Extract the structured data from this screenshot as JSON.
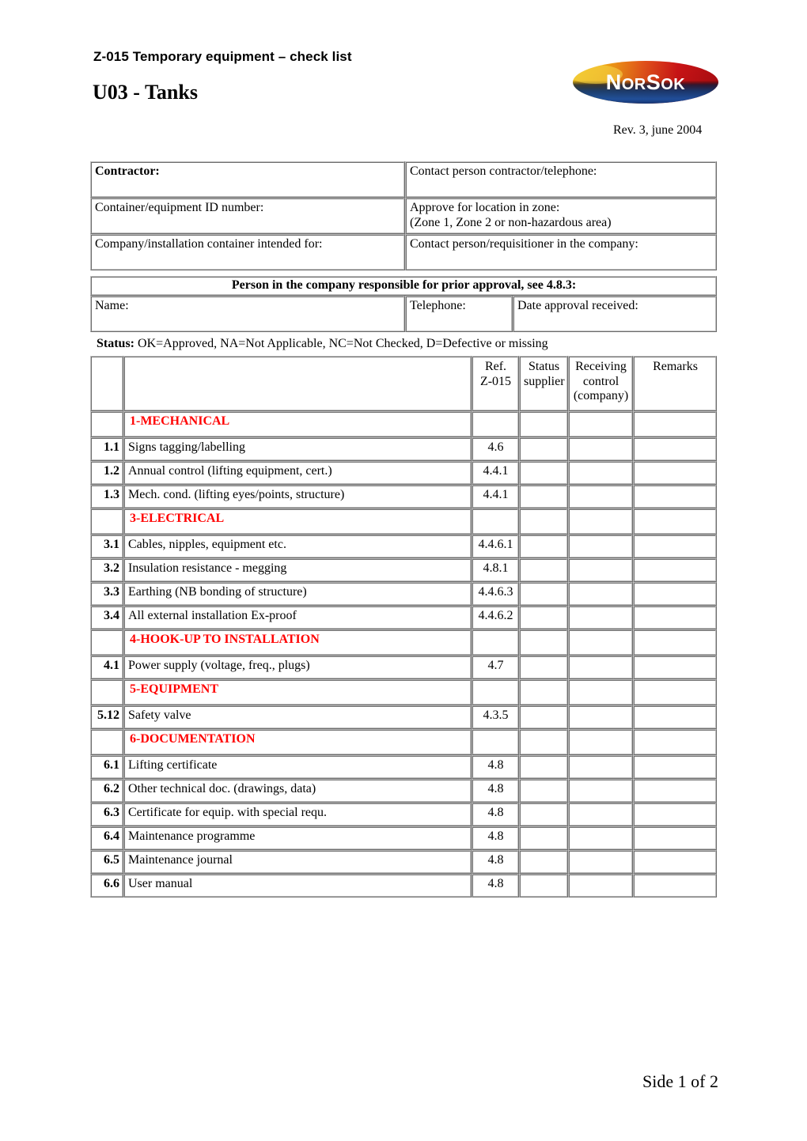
{
  "header": {
    "doc_title": "Z-015 Temporary equipment – check list",
    "doc_subtitle": "U03 - Tanks",
    "revision": "Rev. 3, june 2004",
    "logo_text": "NORSOK"
  },
  "info_table": {
    "rows": [
      {
        "left": "Contractor:",
        "left_bold": true,
        "right": "Contact person contractor/telephone:"
      },
      {
        "left": "Container/equipment ID number:",
        "left_bold": false,
        "right": "Approve for location in zone:\n(Zone 1, Zone 2 or non-hazardous area)"
      },
      {
        "left": "Company/installation container intended for:",
        "left_bold": false,
        "right": "Contact person/requisitioner in the company:"
      }
    ]
  },
  "approval_table": {
    "banner": "Person in the company responsible for prior approval, see 4.8.3:",
    "name_label": "Name:",
    "telephone_label": "Telephone:",
    "date_label": "Date approval received:"
  },
  "status_legend": {
    "label": "Status:",
    "text": " OK=Approved, NA=Not Applicable, NC=Not Checked, D=Defective or missing"
  },
  "checklist": {
    "headers": {
      "num": "",
      "desc": "",
      "ref": "Ref.\nZ-015",
      "status_supplier": "Status\nsupplier",
      "receiving_control": "Receiving\ncontrol\n(company)",
      "remarks": "Remarks"
    },
    "section_color": "#FF0000",
    "rows": [
      {
        "type": "section",
        "label": "1-MECHANICAL"
      },
      {
        "type": "item",
        "num": "1.1",
        "desc": "Signs tagging/labelling",
        "ref": "4.6"
      },
      {
        "type": "item",
        "num": "1.2",
        "desc": "Annual control (lifting equipment, cert.)",
        "ref": "4.4.1"
      },
      {
        "type": "item",
        "num": "1.3",
        "desc": "Mech. cond. (lifting eyes/points, structure)",
        "ref": "4.4.1"
      },
      {
        "type": "section",
        "label": "3-ELECTRICAL"
      },
      {
        "type": "item",
        "num": "3.1",
        "desc": "Cables, nipples, equipment etc.",
        "ref": "4.4.6.1"
      },
      {
        "type": "item",
        "num": "3.2",
        "desc": "Insulation resistance - megging",
        "ref": "4.8.1"
      },
      {
        "type": "item",
        "num": "3.3",
        "desc": "Earthing (NB bonding of structure)",
        "ref": "4.4.6.3"
      },
      {
        "type": "item",
        "num": "3.4",
        "desc": "All external installation Ex-proof",
        "ref": "4.4.6.2"
      },
      {
        "type": "section",
        "label": "4-HOOK-UP TO INSTALLATION"
      },
      {
        "type": "item",
        "num": "4.1",
        "desc": "Power supply (voltage, freq., plugs)",
        "ref": "4.7"
      },
      {
        "type": "section",
        "label": "5-EQUIPMENT"
      },
      {
        "type": "item",
        "num": "5.12",
        "desc": "Safety valve",
        "ref": "4.3.5"
      },
      {
        "type": "section",
        "label": "6-DOCUMENTATION"
      },
      {
        "type": "item",
        "num": "6.1",
        "desc": "Lifting certificate",
        "ref": "4.8"
      },
      {
        "type": "item",
        "num": "6.2",
        "desc": "Other technical doc. (drawings, data)",
        "ref": "4.8"
      },
      {
        "type": "item",
        "num": "6.3",
        "desc": "Certificate for equip. with special requ.",
        "ref": "4.8"
      },
      {
        "type": "item",
        "num": "6.4",
        "desc": "Maintenance programme",
        "ref": "4.8"
      },
      {
        "type": "item",
        "num": "6.5",
        "desc": "Maintenance journal",
        "ref": "4.8"
      },
      {
        "type": "item",
        "num": "6.6",
        "desc": "User manual",
        "ref": "4.8"
      }
    ]
  },
  "footer": {
    "page_label": "Side 1 of 2"
  }
}
